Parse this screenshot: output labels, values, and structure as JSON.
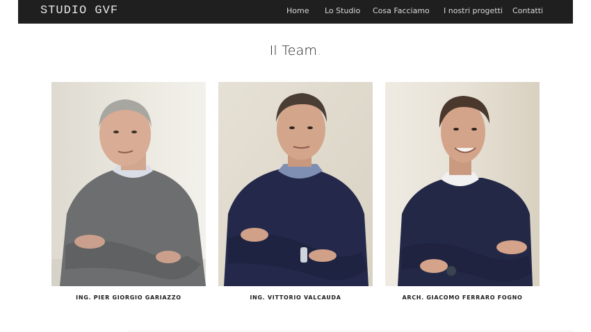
{
  "brand": {
    "logo": "STUDIO GVF"
  },
  "nav": {
    "items": [
      {
        "label": "Home"
      },
      {
        "label": "Lo Studio"
      },
      {
        "label": "Cosa Facciamo"
      },
      {
        "label": "I nostri progetti"
      },
      {
        "label": "Contatti"
      }
    ]
  },
  "team": {
    "title": "Il Team",
    "title_dot": ".",
    "members": [
      {
        "name": "ING. PIER GIORGIO GARIAZZO"
      },
      {
        "name": "ING. VITTORIO VALCAUDA"
      },
      {
        "name": "ARCH. GIACOMO FERRARO FOGNO"
      }
    ]
  },
  "colors": {
    "navbar": "#1f1f1f",
    "accent_title": "#1c1c1c",
    "sweater_grey": "#6c6e6f",
    "sweater_navy": "#24284a"
  }
}
